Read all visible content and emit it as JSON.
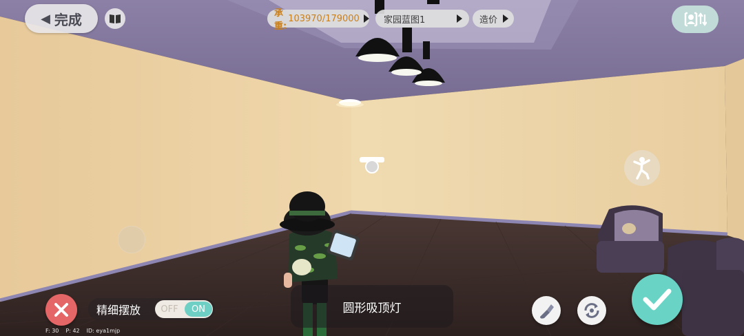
{
  "header": {
    "done_label": "完成",
    "capacity_label": "承重:",
    "capacity_value": "103970/179000",
    "blueprint_label": "家园蓝图1",
    "cost_label": "造价"
  },
  "bottom": {
    "fine_placement_label": "精细摆放",
    "toggle_off_label": "OFF",
    "toggle_on_label": "ON",
    "toggle_state": "on",
    "selected_item_name": "圆形吸顶灯"
  },
  "stats": {
    "f": "F: 30",
    "p": "P: 42",
    "id": "ID: eya1mjp"
  },
  "icons": {
    "back": "chevron-left-icon",
    "book": "book-icon",
    "swap": "person-swap-icon",
    "pose": "pose-icon",
    "cancel": "close-icon",
    "brush": "brush-icon",
    "rotate": "rotate-icon",
    "confirm": "check-icon"
  },
  "colors": {
    "cancel": "#e56666",
    "confirm": "#69d3c5",
    "toggle_on": "#6ecfc4",
    "capacity_text": "#c9801c"
  }
}
